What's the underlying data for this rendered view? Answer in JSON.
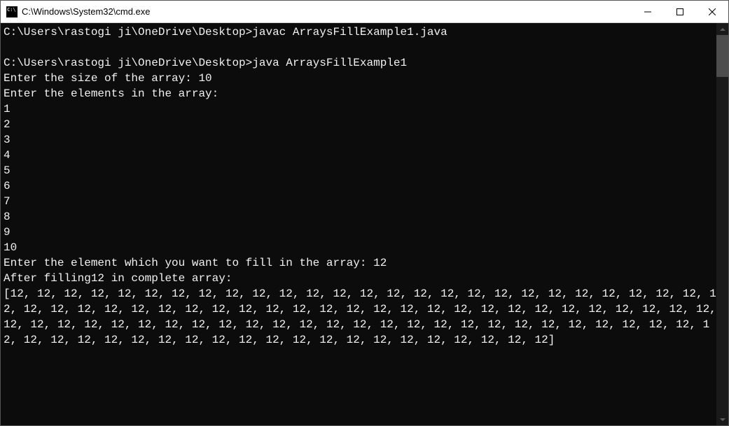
{
  "window": {
    "title": "C:\\Windows\\System32\\cmd.exe"
  },
  "terminal": {
    "lines": [
      "C:\\Users\\rastogi ji\\OneDrive\\Desktop>javac ArraysFillExample1.java",
      "",
      "C:\\Users\\rastogi ji\\OneDrive\\Desktop>java ArraysFillExample1",
      "Enter the size of the array: 10",
      "Enter the elements in the array:",
      "1",
      "2",
      "3",
      "4",
      "5",
      "6",
      "7",
      "8",
      "9",
      "10",
      "Enter the element which you want to fill in the array: 12",
      "After filling12 in complete array:",
      "[12, 12, 12, 12, 12, 12, 12, 12, 12, 12, 12, 12, 12, 12, 12, 12, 12, 12, 12, 12, 12, 12, 12, 12, 12, 12, 12, 12, 12, 12, 12, 12, 12, 12, 12, 12, 12, 12, 12, 12, 12, 12, 12, 12, 12, 12, 12, 12, 12, 12, 12, 12, 12, 12, 12, 12, 12, 12, 12, 12, 12, 12, 12, 12, 12, 12, 12, 12, 12, 12, 12, 12, 12, 12, 12, 12, 12, 12, 12, 12, 12, 12, 12, 12, 12, 12, 12, 12, 12, 12, 12, 12, 12, 12, 12, 12, 12, 12, 12, 12]"
    ]
  }
}
